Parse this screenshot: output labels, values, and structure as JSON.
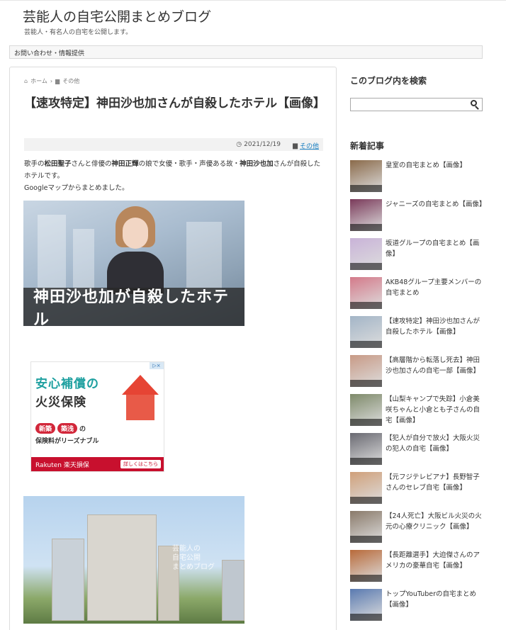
{
  "header": {
    "site_title": "芸能人の自宅公開まとめブログ",
    "site_description": "芸能人・有名人の自宅を公開します。"
  },
  "nav": {
    "contact_label": "お問い合わせ・情報提供"
  },
  "article": {
    "breadcrumb": {
      "home": "ホーム",
      "category": "その他"
    },
    "title": "【速攻特定】神田沙也加さんが自殺したホテル【画像】",
    "date": "2021/12/19",
    "category": "その他",
    "intro": {
      "p1_a": "歌手の",
      "p1_b": "松田聖子",
      "p1_c": "さんと俳優の",
      "p1_d": "神田正輝",
      "p1_e": "の娘で女優・歌手・声優ある故・",
      "p1_f": "神田沙也加",
      "p1_g": "さんが自殺したホテルです。",
      "p2": "Googleマップからまとめました。"
    },
    "image1_caption": "神田沙也加が自殺したホテル",
    "ad": {
      "headline1": "安心補償の",
      "headline2": "火災保険",
      "badge1": "新築",
      "badge2": "築浅",
      "badge_tail": "の",
      "text": "保険料がリーズナブル",
      "brand": "Rakuten 楽天損保",
      "cta": "詳しくはこちら"
    },
    "image2_watermark_1": "芸能人の",
    "image2_watermark_2": "自宅公開",
    "image2_watermark_3": "まとめブログ"
  },
  "sidebar": {
    "search_heading": "このブログ内を検索",
    "search_placeholder": "",
    "recent_heading": "新着記事",
    "recent_posts": [
      {
        "title": "皇室の自宅まとめ【画像】",
        "thumb_color": "#8a6a4a"
      },
      {
        "title": "ジャニーズの自宅まとめ【画像】",
        "thumb_color": "#7a3a5a"
      },
      {
        "title": "坂道グループの自宅まとめ【画像】",
        "thumb_color": "#c9b3d8"
      },
      {
        "title": "AKB48グループ主要メンバーの自宅まとめ",
        "thumb_color": "#d47a8a"
      },
      {
        "title": "【速攻特定】神田沙也加さんが自殺したホテル【画像】",
        "thumb_color": "#a3b5c7"
      },
      {
        "title": "【高層階から転落し死去】神田沙也加さんの自宅一部【画像】",
        "thumb_color": "#c89a86"
      },
      {
        "title": "【山梨キャンプで失踪】小倉美咲ちゃんと小倉とも子さんの自宅【画像】",
        "thumb_color": "#7e8a6a"
      },
      {
        "title": "【犯人が自分で放火】大阪火災の犯人の自宅【画像】",
        "thumb_color": "#6a6a72"
      },
      {
        "title": "【元フジテレビアナ】長野智子さんのセレブ自宅【画像】",
        "thumb_color": "#d0a07a"
      },
      {
        "title": "【24人死亡】大阪ビル火災の火元の心療クリニック【画像】",
        "thumb_color": "#8a7a6a"
      },
      {
        "title": "【長距離選手】大迫傑さんのアメリカの豪華自宅【画像】",
        "thumb_color": "#b86a3a"
      },
      {
        "title": "トップYouTuberの自宅まとめ【画像】",
        "thumb_color": "#5a7ab0"
      }
    ]
  }
}
